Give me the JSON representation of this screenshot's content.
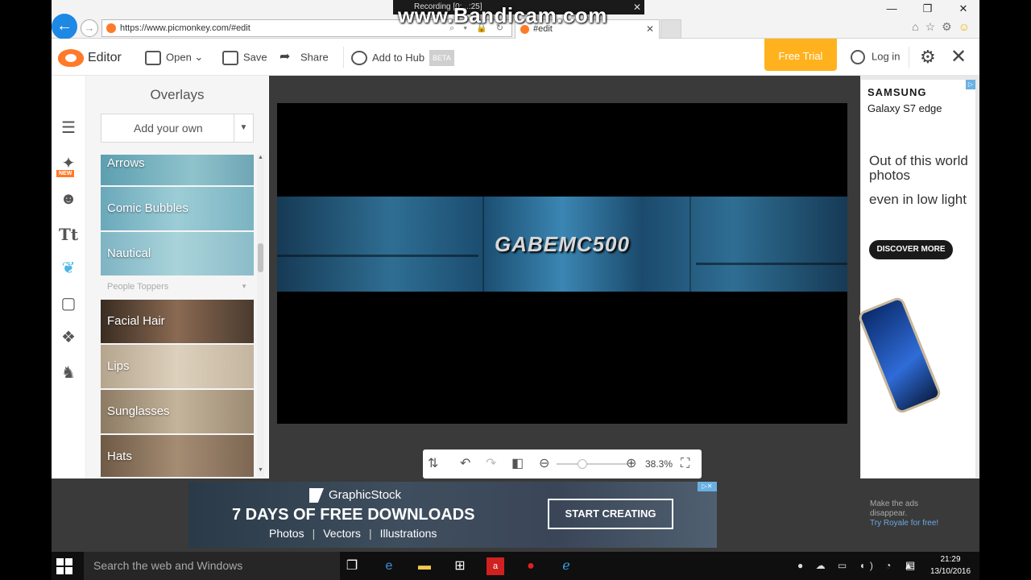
{
  "browser": {
    "url": "https://www.picmonkey.com/#edit",
    "tab_title": "#edit",
    "tab_close": "✕",
    "window_controls": [
      "—",
      "❐",
      "✕"
    ],
    "watermark": "www.Bandicam.com",
    "recorder_status": "Recording [0:...:25]",
    "recorder_close": "✕",
    "nav_back": "←",
    "nav_forward": "→",
    "addr_tools": "⌕ ▾ 🔒 ↻"
  },
  "toolbar": {
    "app_name": "Editor",
    "open_label": "Open",
    "save_label": "Save",
    "share_label": "Share",
    "hub_label": "Add to Hub",
    "beta_label": "BETA",
    "free_trial_label": "Free Trial",
    "login_label": "Log in"
  },
  "rail": {
    "new_badge": "NEW",
    "text_tool": "Tt"
  },
  "panel": {
    "title": "Overlays",
    "add_your_own": "Add your own",
    "items": [
      {
        "label": "Arrows"
      },
      {
        "label": "Comic Bubbles"
      },
      {
        "label": "Nautical"
      }
    ],
    "group_header": "People Toppers",
    "people_items": [
      {
        "label": "Facial Hair"
      },
      {
        "label": "Lips"
      },
      {
        "label": "Sunglasses"
      },
      {
        "label": "Hats"
      }
    ]
  },
  "canvas": {
    "banner_text": "GABEMC500"
  },
  "zoom": {
    "value": "38.3%"
  },
  "ad_right": {
    "brand": "SAMSUNG",
    "product": "Galaxy S7 edge",
    "line1": "Out of this world photos",
    "line2": "even in low light",
    "cta": "DISCOVER MORE",
    "badge": "▷"
  },
  "ad_bottom": {
    "brand": "GraphicStock",
    "headline": "7 DAYS OF FREE DOWNLOADS",
    "categories": [
      "Photos",
      "Vectors",
      "Illustrations"
    ],
    "cta": "START CREATING",
    "badge": "▷✕",
    "royale_line1": "Make the ads",
    "royale_line2": "disappear.",
    "royale_link": "Try Royale for free!"
  },
  "taskbar": {
    "search_placeholder": "Search the web and Windows",
    "time": "21:29",
    "date": "13/10/2016"
  },
  "colors": {
    "accent_orange": "#ff7a29",
    "free_trial": "#ffb21e",
    "active_tool": "#4ab6e8"
  }
}
